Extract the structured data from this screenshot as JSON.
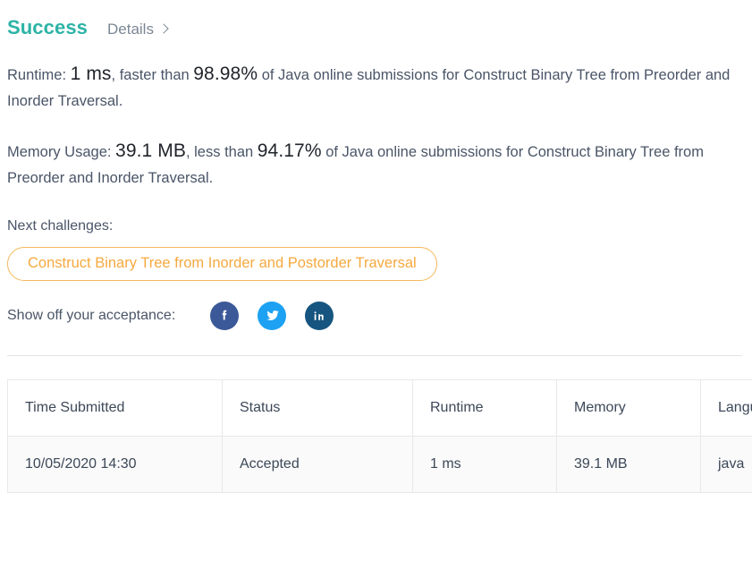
{
  "header": {
    "status": "Success",
    "details_label": "Details",
    "chevron_icon": "chevron-right-icon"
  },
  "stats": {
    "runtime": {
      "prefix": "Runtime:",
      "value": "1 ms",
      "middle": ", faster than",
      "percentile": "98.98%",
      "suffix": "of Java online submissions for Construct Binary Tree from Preorder and Inorder Traversal."
    },
    "memory": {
      "prefix": "Memory Usage:",
      "value": "39.1 MB",
      "middle": ", less than",
      "percentile": "94.17%",
      "suffix": "of Java online submissions for Construct Binary Tree from Preorder and Inorder Traversal."
    }
  },
  "next_challenges": {
    "label": "Next challenges:",
    "items": [
      {
        "label": "Construct Binary Tree from Inorder and Postorder Traversal"
      }
    ]
  },
  "share": {
    "label": "Show off your acceptance:",
    "buttons": [
      {
        "name": "facebook",
        "icon": "facebook-icon",
        "color": "#3b5998"
      },
      {
        "name": "twitter",
        "icon": "twitter-icon",
        "color": "#1da1f2"
      },
      {
        "name": "linkedin",
        "icon": "linkedin-icon",
        "color": "#16557f"
      }
    ]
  },
  "submissions_table": {
    "columns": [
      "Time Submitted",
      "Status",
      "Runtime",
      "Memory",
      "Language"
    ],
    "rows": [
      {
        "time_submitted": "10/05/2020 14:30",
        "status": "Accepted",
        "runtime": "1 ms",
        "memory": "39.1 MB",
        "language": "java"
      }
    ]
  },
  "colors": {
    "success_teal": "#2db3a6",
    "accepted_teal": "#0fa3a3",
    "challenge_orange": "#f5a93f",
    "body_text": "#4a5568"
  }
}
